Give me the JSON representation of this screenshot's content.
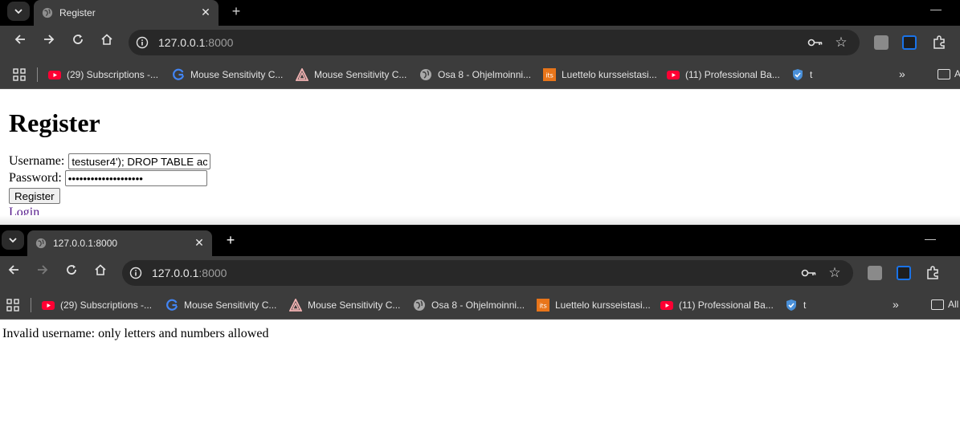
{
  "windows": [
    {
      "tab_title": "Register",
      "url_host": "127.0.0.1",
      "url_port": ":8000",
      "page": {
        "heading": "Register",
        "username_label": "Username:",
        "username_value": "testuser4'); DROP TABLE ac",
        "password_label": "Password:",
        "password_value": "••••••••••••••••••••",
        "register_button": "Register",
        "login_link": "Login"
      }
    },
    {
      "tab_title": "127.0.0.1:8000",
      "url_host": "127.0.0.1",
      "url_port": ":8000",
      "page": {
        "error_message": "Invalid username: only letters and numbers allowed"
      }
    }
  ],
  "tabstrip": {
    "close_glyph": "✕",
    "newtab_glyph": "+",
    "minimize_glyph": "—"
  },
  "bookmarks": [
    {
      "label": "(29) Subscriptions -...",
      "icon": "youtube-icon"
    },
    {
      "label": "Mouse Sensitivity C...",
      "icon": "google-icon"
    },
    {
      "label": "Mouse Sensitivity C...",
      "icon": "triangle-logo-icon"
    },
    {
      "label": "Osa 8 - Ohjelmoinni...",
      "icon": "globe-icon"
    },
    {
      "label": "Luettelo kursseistasi...",
      "icon": "its-icon"
    },
    {
      "label": "(11) Professional Ba...",
      "icon": "youtube-icon"
    },
    {
      "label": "t",
      "icon": "shield-icon"
    }
  ],
  "bookmarks_more": "»",
  "bookmarks_folder": "All",
  "colors": {
    "tabstrip_bg": "#000000",
    "toolbar_bg": "#3c3c3c",
    "omnibox_bg": "#282828",
    "youtube_red": "#ff0033",
    "google_blue": "#4285f4",
    "its_orange": "#e8751a",
    "shield_blue": "#4a90d9",
    "visited_link": "#551a8b"
  }
}
